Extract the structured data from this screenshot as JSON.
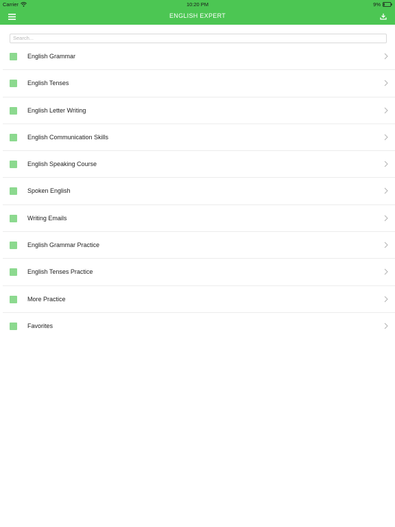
{
  "status_bar": {
    "carrier": "Carrier",
    "time": "10:20 PM",
    "battery": "9%"
  },
  "nav_bar": {
    "title": "ENGLISH EXPERT",
    "menu_icon": "hamburger-menu-icon",
    "download_icon": "download-icon"
  },
  "search": {
    "placeholder": "Search...",
    "value": ""
  },
  "menu": {
    "items": [
      {
        "label": "English Grammar"
      },
      {
        "label": "English Tenses"
      },
      {
        "label": "English Letter Writing"
      },
      {
        "label": "English Communication Skills"
      },
      {
        "label": "English Speaking Course"
      },
      {
        "label": "Spoken English"
      },
      {
        "label": "Writing Emails"
      },
      {
        "label": "English Grammar Practice"
      },
      {
        "label": "English Tenses Practice"
      },
      {
        "label": "More Practice"
      },
      {
        "label": "Favorites"
      }
    ]
  },
  "colors": {
    "brand": "#4cc653",
    "item_icon": "#8cd98f",
    "chevron": "#b5b5b5"
  }
}
